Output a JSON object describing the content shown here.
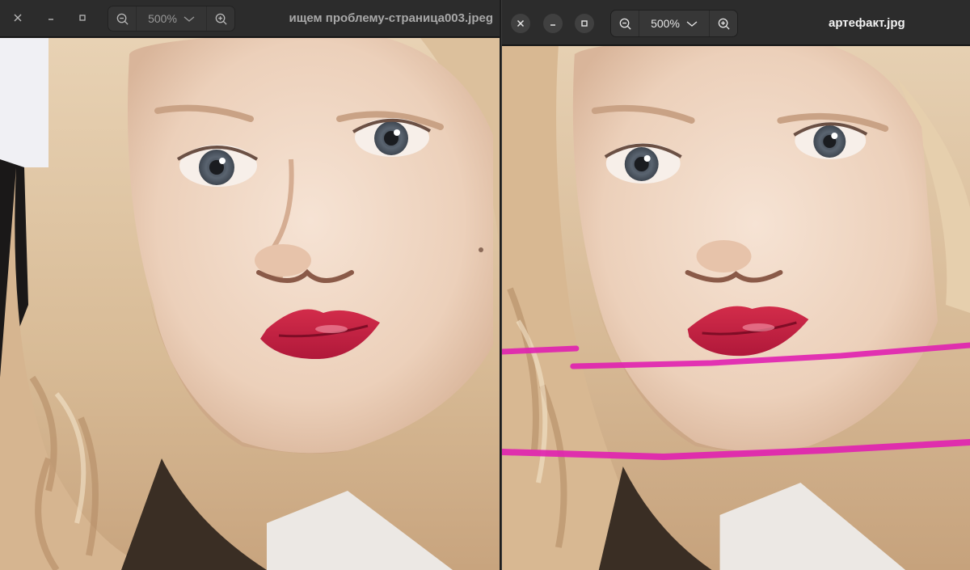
{
  "left_window": {
    "title": "ищем проблему-страница003.jpeg",
    "zoom": {
      "value": "500%"
    },
    "buttons": {
      "close": "close-icon",
      "minimize": "minimize-icon",
      "maximize": "maximize-icon"
    }
  },
  "right_window": {
    "title": "артефакт.jpg",
    "zoom": {
      "value": "500%"
    },
    "buttons": {
      "close": "close-icon",
      "minimize": "minimize-icon",
      "maximize": "maximize-icon"
    },
    "annotation_color": "#e020b0"
  },
  "colors": {
    "headerbar": "#2c2c2c",
    "button_bg": "#404040",
    "text_active": "#f2f2f2",
    "text_inactive": "#a8a8a8"
  }
}
